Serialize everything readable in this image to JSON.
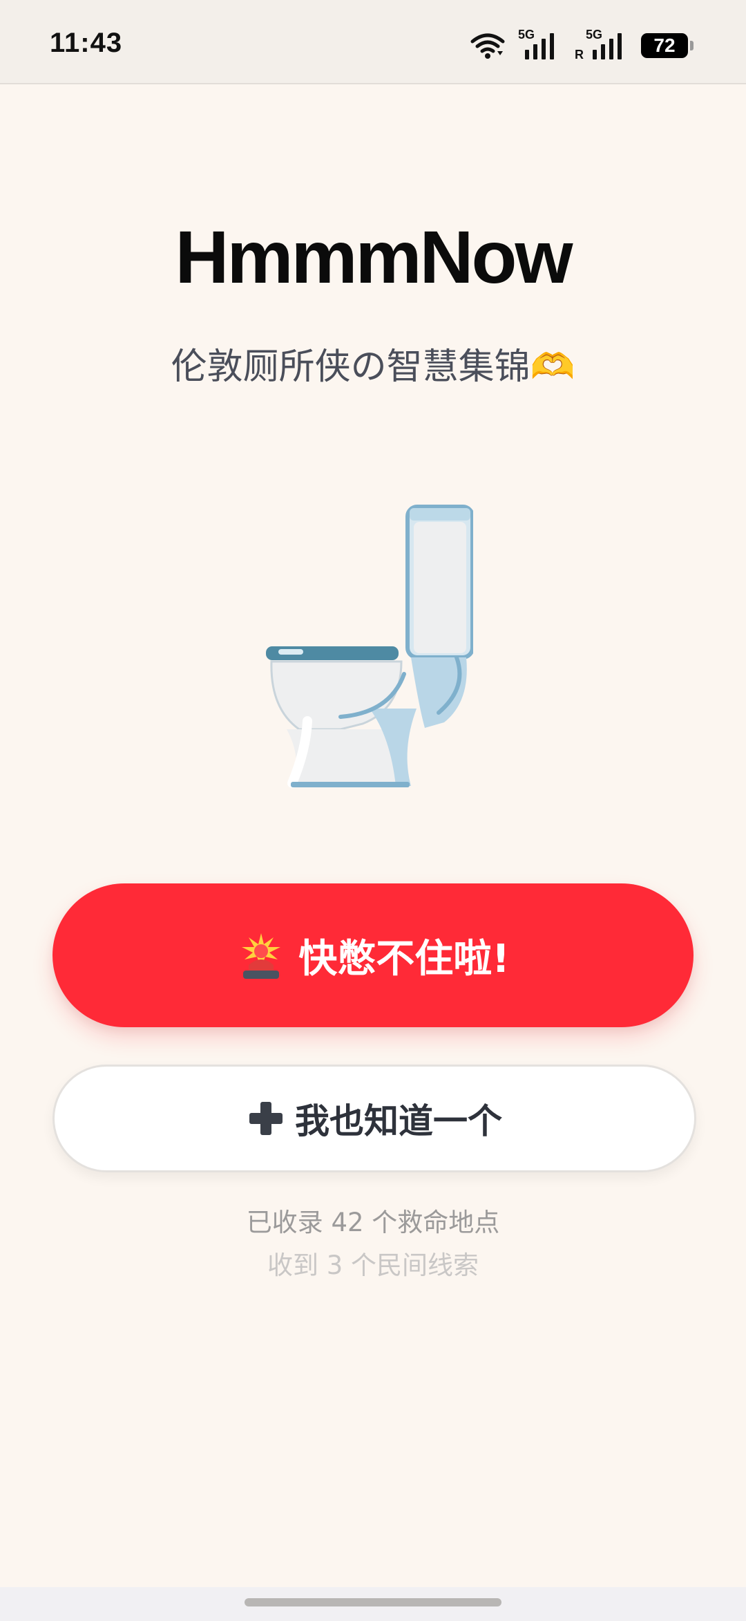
{
  "status_bar": {
    "time": "11:43",
    "network_1": "5G",
    "network_2": "5G",
    "roaming": "R",
    "battery": "72"
  },
  "header": {
    "title": "HmmmNow",
    "subtitle": "伦敦厕所侠の智慧集锦🫶"
  },
  "illustration": {
    "icon": "toilet-icon"
  },
  "actions": {
    "urgent_label": "快憋不住啦!",
    "urgent_icon": "siren-icon",
    "add_label": "我也知道一个",
    "add_icon": "plus-icon"
  },
  "stats": {
    "line1": "已收录 42 个救命地点",
    "line2": "收到 3 个民间线索"
  },
  "colors": {
    "background": "#FCF6F0",
    "accent_red": "#FF2A37",
    "text_dark": "#0B0B0B",
    "text_muted": "#9B9A9A"
  }
}
